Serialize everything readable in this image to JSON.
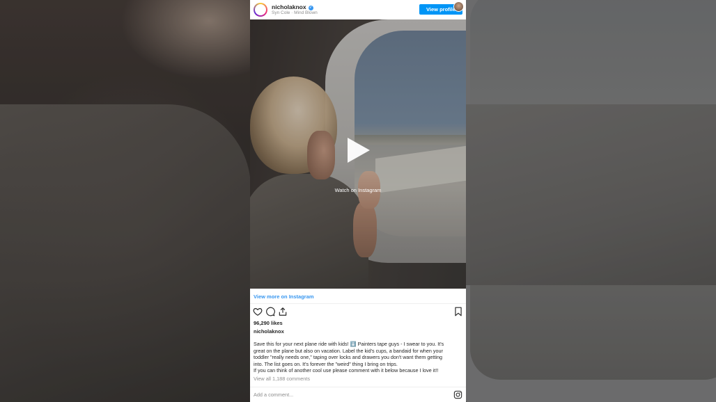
{
  "post": {
    "username": "nicholaknox",
    "verified_badge": "✓",
    "subtitle": "Syn Cole · Mind Blown",
    "view_profile_label": "View profile",
    "watch_label": "Watch on Instagram",
    "view_more_label": "View more on Instagram",
    "likes": "96,290 likes",
    "caption_user": "nicholaknox",
    "caption_lines": [
      "Save this for your next plane ride with kids! ⬇️ Painters tape guys - I swear to you. It's",
      "great on the plane but also on vacation. Label the kid's cups, a bandaid for when your",
      "toddler \"really needs one,\" taping over locks and drawers you don't want them getting",
      "into. The list goes on. It's forever the \"weird\" thing I bring on trips.",
      "If you can think of another cool use please comment with it below because I love it!!"
    ],
    "view_comments_label": "View all 1,188 comments",
    "add_comment_placeholder": "Add a comment..."
  },
  "icons": {
    "like": "heart-icon",
    "comment": "comment-icon",
    "share": "share-icon",
    "save": "bookmark-icon",
    "play": "play-icon",
    "instagram": "instagram-icon",
    "verified": "verified-icon"
  },
  "colors": {
    "accent": "#0095f6",
    "link": "#3897f0",
    "text": "#262626",
    "muted": "#8e8e8e"
  }
}
